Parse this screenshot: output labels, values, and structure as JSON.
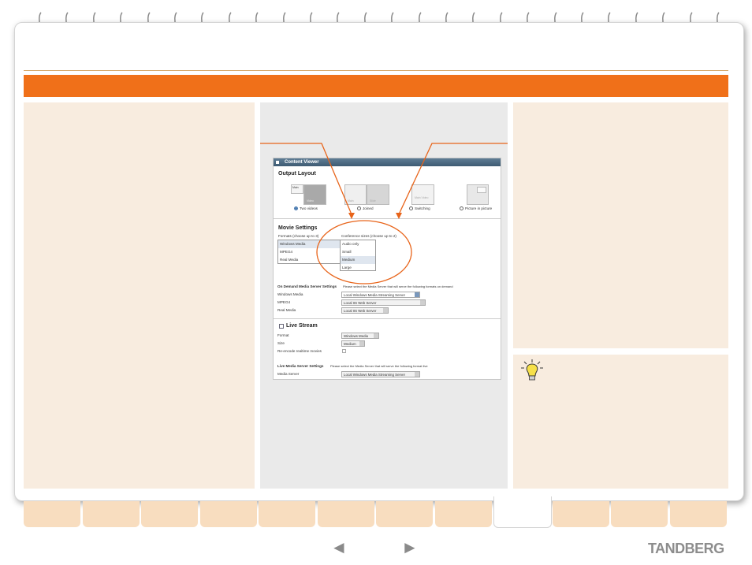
{
  "content_viewer": {
    "title": "Content Viewer",
    "output_layout": {
      "heading": "Output Layout",
      "options": [
        {
          "label": "Two videos",
          "selected": true
        },
        {
          "label": "Joined",
          "selected": false
        },
        {
          "label": "Switching",
          "selected": false
        },
        {
          "label": "Picture in picture",
          "selected": false
        }
      ],
      "thumb_labels": {
        "main": "Main",
        "video": "Video",
        "slide": "Slide",
        "main_video": "Main Video"
      }
    },
    "movie_settings": {
      "heading": "Movie Settings",
      "formats_label": "Formats (choose up to 3)",
      "formats": [
        {
          "label": "Windows Media",
          "selected": true
        },
        {
          "label": "MPEG4",
          "selected": false
        },
        {
          "label": "Real Media",
          "selected": false
        }
      ],
      "sizes_label": "Conference sizes (choose up to 2)",
      "sizes": [
        {
          "label": "Audio only",
          "selected": false
        },
        {
          "label": "Small",
          "selected": false
        },
        {
          "label": "Medium",
          "selected": true
        },
        {
          "label": "Large",
          "selected": false
        }
      ]
    },
    "on_demand": {
      "heading": "On Demand Media Server Settings",
      "note": "Please select the Media Server that will serve the following formats on demand",
      "rows": [
        {
          "label": "Windows Media",
          "value": "Local Windows Media Streaming Server"
        },
        {
          "label": "MPEG4",
          "value": "Local IIS Web Server"
        },
        {
          "label": "Real Media",
          "value": "Local IIS Web Server"
        }
      ]
    },
    "live_stream": {
      "heading": "Live Stream",
      "format_label": "Format",
      "format_value": "Windows Media",
      "size_label": "Size",
      "size_value": "Medium",
      "reencode_label": "Re-encode realtime movies"
    },
    "live_server": {
      "heading": "Live Media Server Settings",
      "note": "Please select the Media Server that will serve the following format live",
      "label": "Media Server",
      "value": "Local Windows Media Streaming Server"
    }
  },
  "nav": {
    "prev_glyph": "◄",
    "next_glyph": "►",
    "active_tab_index": 8
  },
  "brand": {
    "logo": "TANDBERG"
  },
  "colors": {
    "accent_orange": "#f07019",
    "panel_beige": "#f8ecdf",
    "tab_beige": "#f8ddbf",
    "callout_orange": "#e8641a"
  }
}
